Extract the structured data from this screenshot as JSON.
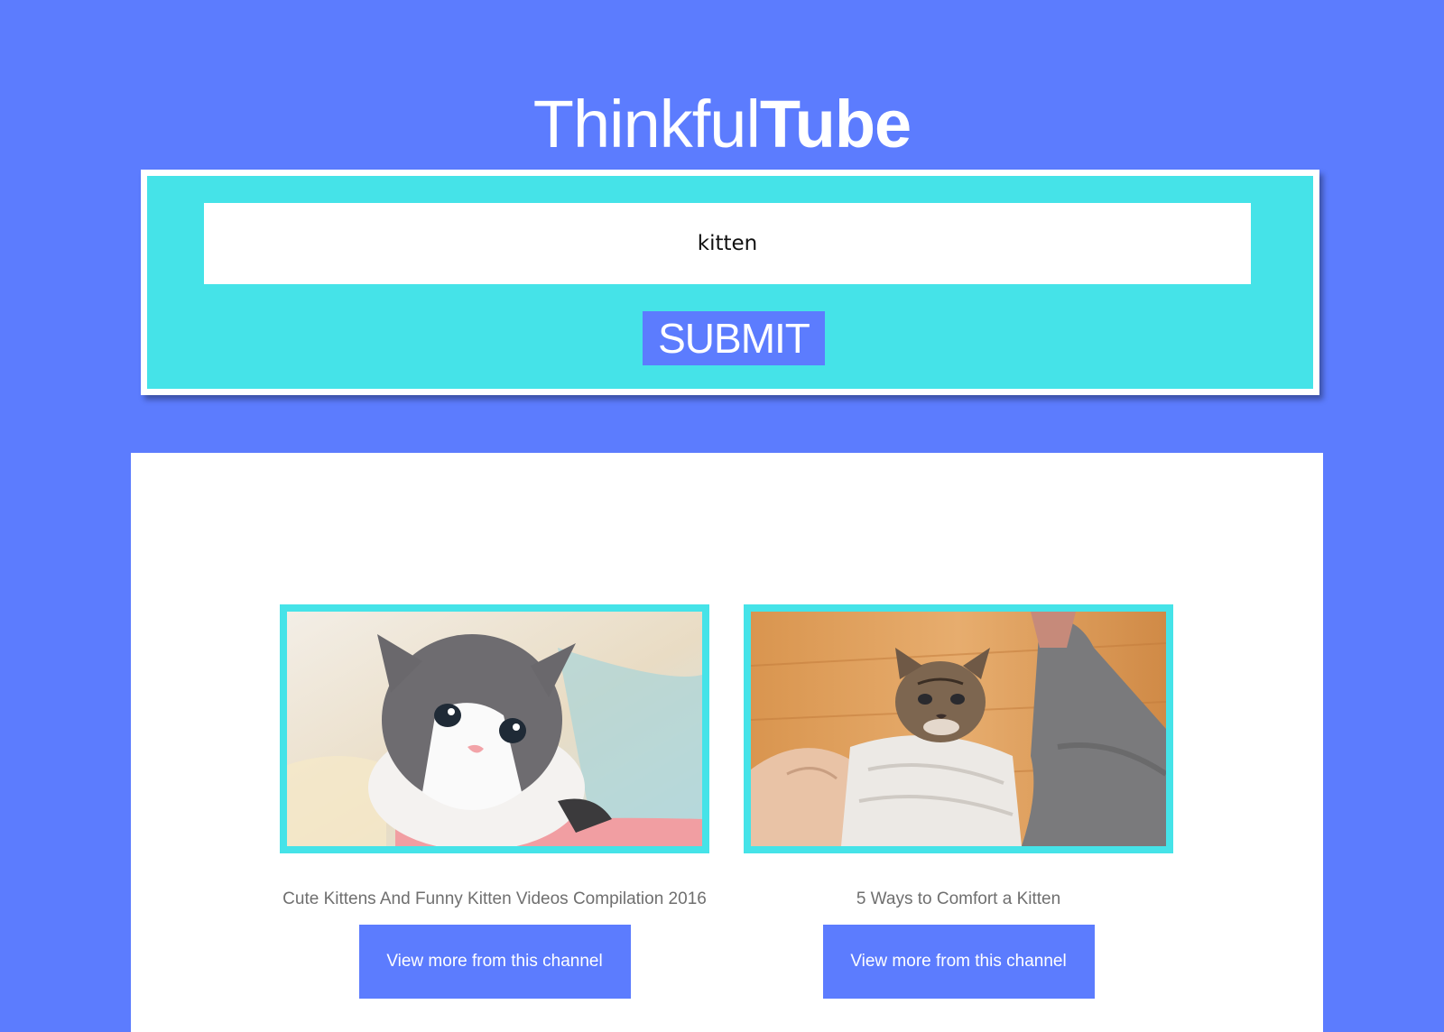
{
  "header": {
    "title_light": "Thinkful",
    "title_bold": "Tube"
  },
  "search": {
    "value": "kitten",
    "submit_label": "SUBMIT"
  },
  "results": [
    {
      "title": "Cute Kittens And Funny Kitten Videos Compilation 2016",
      "button_label": "View more from this channel"
    },
    {
      "title": "5 Ways to Comfort a Kitten",
      "button_label": "View more from this channel"
    }
  ],
  "colors": {
    "background": "#5c7cfe",
    "accent": "#45e3e8",
    "panel": "#ffffff"
  }
}
